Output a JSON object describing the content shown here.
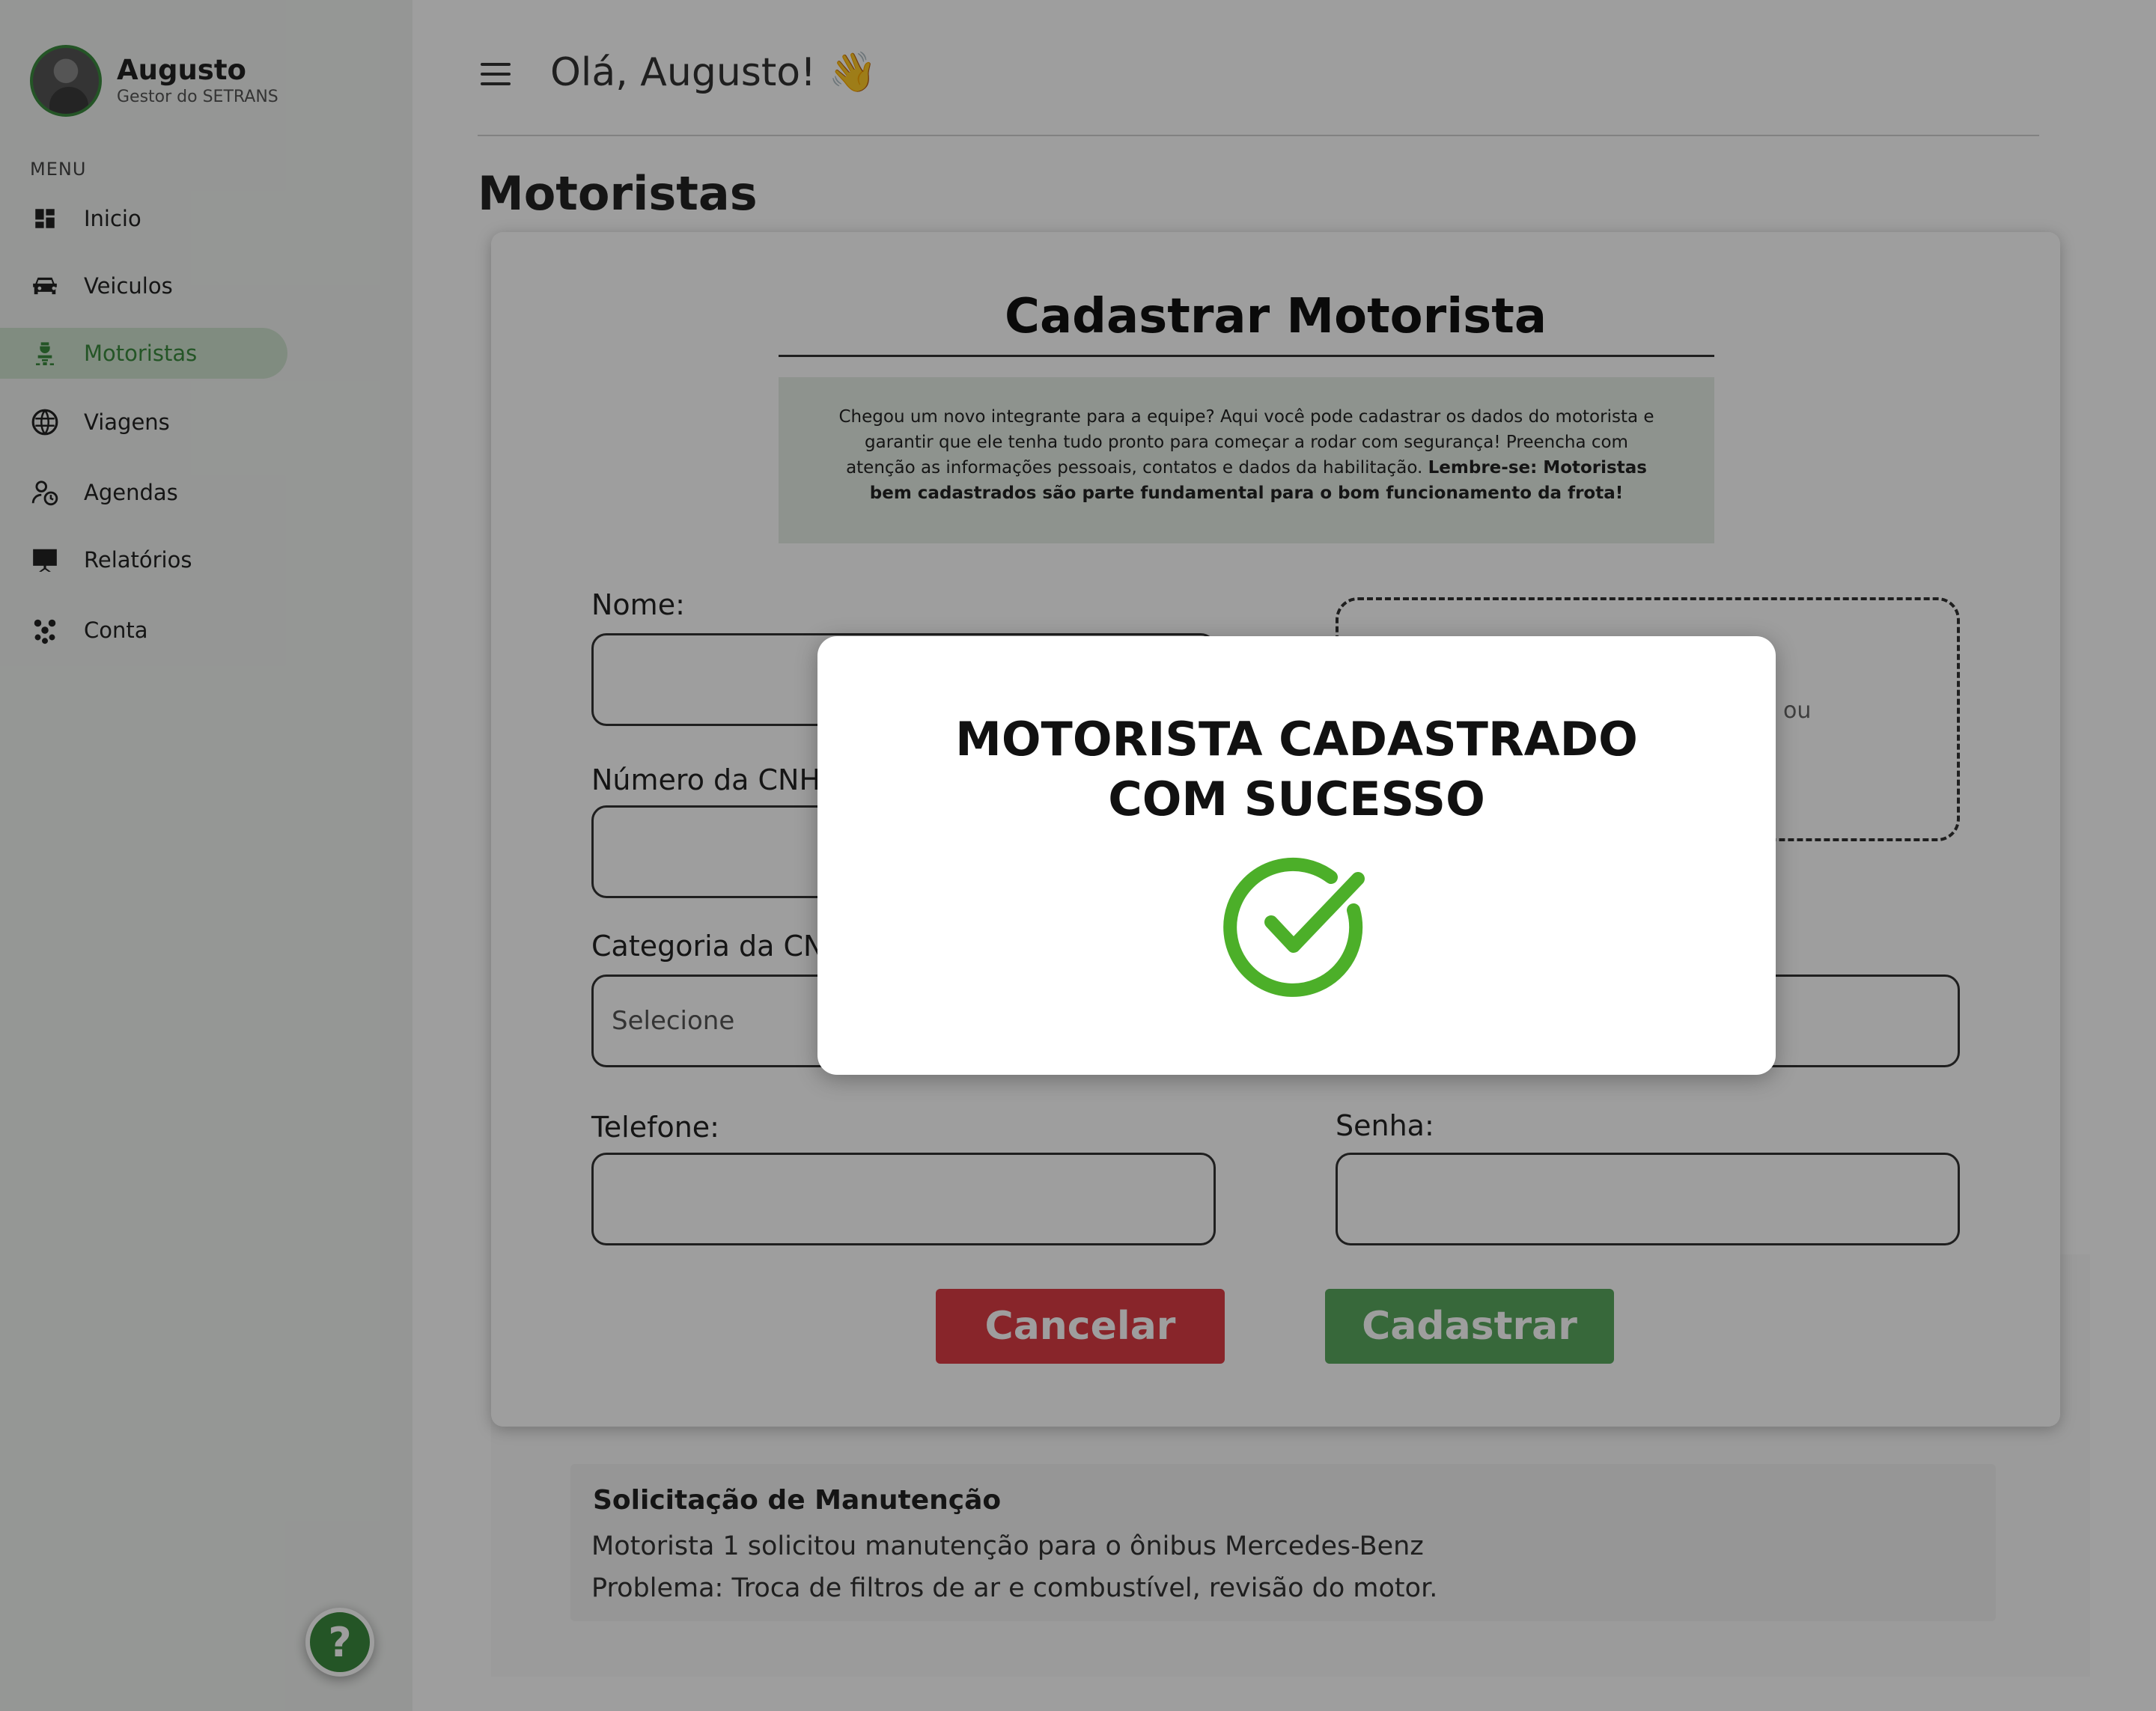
{
  "sidebar": {
    "user_name": "Augusto",
    "user_role": "Gestor do SETRANS",
    "menu_title": "MENU",
    "items": [
      {
        "label": "Inicio",
        "icon": "dashboard-icon"
      },
      {
        "label": "Veiculos",
        "icon": "car-icon"
      },
      {
        "label": "Motoristas",
        "icon": "driver-icon",
        "active": true
      },
      {
        "label": "Viagens",
        "icon": "globe-icon"
      },
      {
        "label": "Agendas",
        "icon": "schedule-icon"
      },
      {
        "label": "Relatórios",
        "icon": "report-icon"
      },
      {
        "label": "Conta",
        "icon": "account-icon"
      }
    ],
    "help_label": "?"
  },
  "header": {
    "greeting": "Olá, Augusto! 👋"
  },
  "page": {
    "title": "Motoristas"
  },
  "form": {
    "title": "Cadastrar Motorista",
    "intro": "Chegou um novo integrante para a equipe? Aqui você pode cadastrar os dados do motorista e garantir que ele tenha tudo pronto para começar a rodar com segurança! Preencha com atenção as informações pessoais, contatos e dados da habilitação.",
    "intro_bold": "Lembre-se: Motoristas bem cadastrados são parte fundamental para o bom funcionamento da frota!",
    "name_label": "Nome:",
    "cnh_label": "Número da CNH:",
    "category_label": "Categoria da CNH",
    "category_placeholder": "Selecione",
    "phone_label": "Telefone:",
    "password_label": "Senha:",
    "dropzone_partial_text": "ou",
    "cancel_label": "Cancelar",
    "submit_label": "Cadastrar"
  },
  "maintenance": {
    "title": "Solicitação de Manutenção",
    "line1": "Motorista 1 solicitou manutenção para o ônibus Mercedes-Benz",
    "line2": "Problema: Troca de filtros de ar e combustível, revisão do motor."
  },
  "modal": {
    "title_line1": "MOTORISTA CADASTRADO",
    "title_line2": "COM SUCESSO",
    "icon": "check-circle-icon"
  },
  "colors": {
    "accent": "#3a8a3e",
    "danger": "#dc3c45",
    "success": "#4caf29"
  }
}
